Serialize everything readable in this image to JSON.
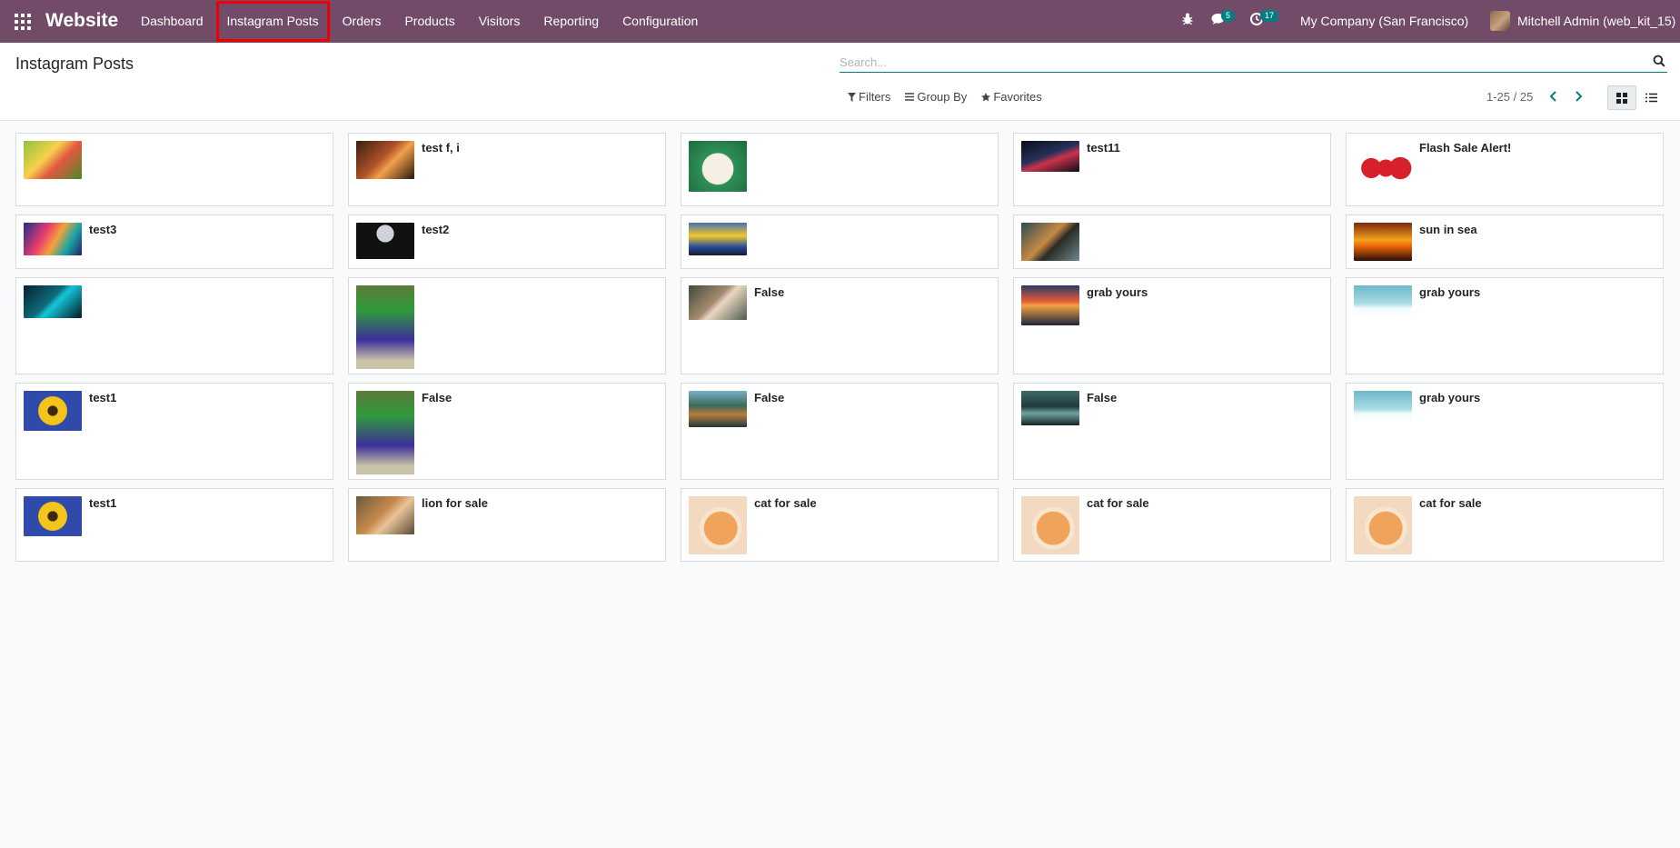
{
  "navbar": {
    "brand": "Website",
    "menu": [
      "Dashboard",
      "Instagram Posts",
      "Orders",
      "Products",
      "Visitors",
      "Reporting",
      "Configuration"
    ],
    "highlighted_menu": "Instagram Posts",
    "chat_badge": "5",
    "activity_badge": "17",
    "company": "My Company (San Francisco)",
    "user": "Mitchell Admin (web_kit_15)",
    "colors": {
      "bar": "#714b67",
      "badge": "#017e84"
    }
  },
  "control_panel": {
    "title": "Instagram Posts",
    "search_placeholder": "Search...",
    "filters_label": "Filters",
    "group_by_label": "Group By",
    "favorites_label": "Favorites",
    "pager": "1-25 / 25"
  },
  "cards": [
    {
      "title": "",
      "image": "krishna"
    },
    {
      "title": "test f, i",
      "image": "autumn"
    },
    {
      "title": "",
      "image": "puppy"
    },
    {
      "title": "test11",
      "image": "car"
    },
    {
      "title": "Flash Sale Alert!",
      "image": "sale"
    },
    {
      "title": "test3",
      "image": "abstract"
    },
    {
      "title": "test2",
      "image": "planet"
    },
    {
      "title": "",
      "image": "minion"
    },
    {
      "title": "",
      "image": "tiger"
    },
    {
      "title": "sun in sea",
      "image": "sunsea"
    },
    {
      "title": "",
      "image": "cyber"
    },
    {
      "title": "",
      "image": "parrot"
    },
    {
      "title": "False",
      "image": "monkey"
    },
    {
      "title": "grab yours",
      "image": "grab1"
    },
    {
      "title": "grab yours",
      "image": "xmas"
    },
    {
      "title": "test1",
      "image": "sunflower"
    },
    {
      "title": "False",
      "image": "parrot"
    },
    {
      "title": "False",
      "image": "lake"
    },
    {
      "title": "False",
      "image": "forest"
    },
    {
      "title": "grab yours",
      "image": "xmas"
    },
    {
      "title": "test1",
      "image": "sunflower"
    },
    {
      "title": "lion for sale",
      "image": "lion"
    },
    {
      "title": "cat for sale",
      "image": "cat"
    },
    {
      "title": "cat for sale",
      "image": "cat"
    },
    {
      "title": "cat for sale",
      "image": "cat"
    }
  ]
}
